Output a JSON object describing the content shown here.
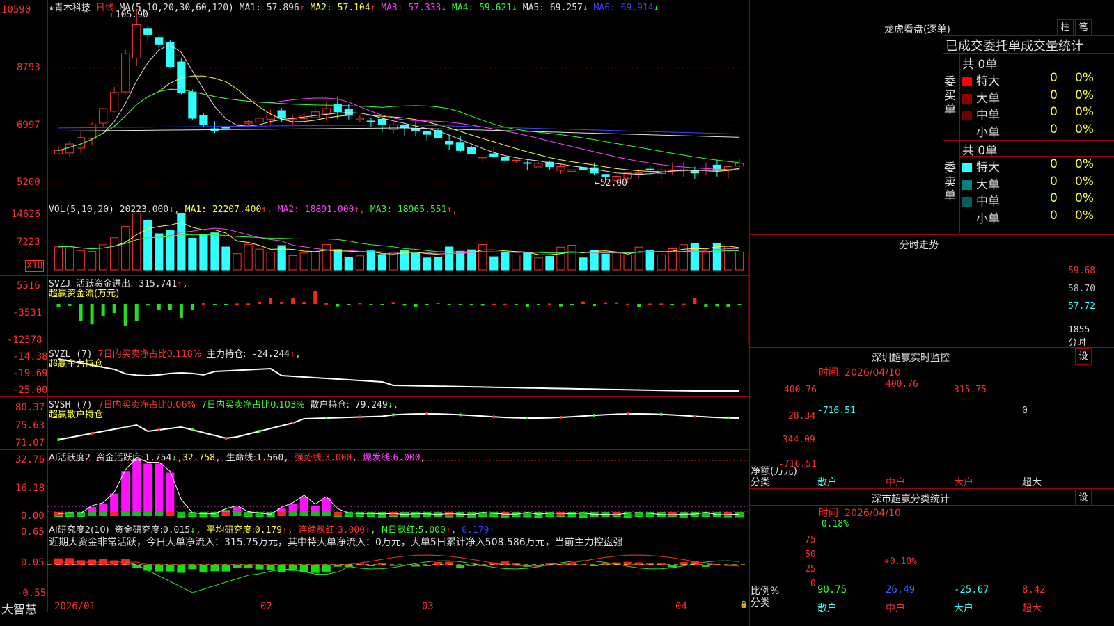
{
  "stock": {
    "name": "青木科技",
    "star": "★",
    "period": "日线"
  },
  "main_chart": {
    "ma_label": "MA(5,10,20,30,60,120)",
    "ma": [
      {
        "label": "MA1:",
        "value": "57.896",
        "arrow": "↑",
        "color": "#e0e0e0"
      },
      {
        "label": "MA2:",
        "value": "57.104",
        "arrow": "↑",
        "color": "#ffff30"
      },
      {
        "label": "MA3:",
        "value": "57.333",
        "arrow": "↓",
        "color": "#ff40ff"
      },
      {
        "label": "MA4:",
        "value": "59.621",
        "arrow": "↓",
        "color": "#30ff30"
      },
      {
        "label": "MA5:",
        "value": "69.257",
        "arrow": "↓",
        "color": "#e0e0e0"
      },
      {
        "label": "MA6:",
        "value": "69.914",
        "arrow": "↓",
        "color": "#4040ff"
      }
    ],
    "y_ticks": [
      "10590",
      "8793",
      "6997",
      "5200"
    ],
    "high_label": "105.90",
    "low_label": "52.00"
  },
  "vol": {
    "title": "VOL(5,10,20)",
    "value": "20223.000",
    "value_arrow": "↓",
    "ma": [
      {
        "label": "MA1:",
        "value": "22207.400",
        "arrow": "↑",
        "color": "#ffff30"
      },
      {
        "label": "MA2:",
        "value": "18891.000",
        "arrow": "↑",
        "color": "#ff40ff"
      },
      {
        "label": "MA3:",
        "value": "18965.551",
        "arrow": "↑",
        "color": "#30ff30"
      }
    ],
    "y_ticks": [
      "14626",
      "7223"
    ],
    "unit": "X10"
  },
  "svzj": {
    "title": "SVZJ",
    "text": "活跃资金进出:",
    "value": "315.741",
    "arrow": "↑",
    "sub": "超赢资金流(万元)",
    "y_ticks": [
      "5516",
      "-3531",
      "-12578"
    ]
  },
  "svzl": {
    "title": "SVZL (7)",
    "text1": "7日内买卖净占比0.118%",
    "text2": "主力持仓:",
    "value": "-24.244",
    "arrow": "↑",
    "sub": "超赢主力持仓",
    "y_ticks": [
      "-14.38",
      "-19.69",
      "-25.00"
    ]
  },
  "svsh": {
    "title": "SVSH (7)",
    "text1": "7日内买卖净占比0.06%",
    "text2": "7日内买卖净占比0.103%",
    "text3": "散户持仓:",
    "value": "79.249",
    "arrow": "↓",
    "sub": "超赢散户持仓",
    "y_ticks": [
      "80.37",
      "75.63",
      "71.07"
    ]
  },
  "ai1": {
    "title": "AI活跃度2",
    "t1": "资金活跃度:",
    "v1": "1.754",
    "a1": "↓",
    "v2": "32.758",
    "t3": "生命线:",
    "v3": "1.560",
    "t4": "强势线:",
    "v4": "3.000",
    "t5": "爆发线:",
    "v5": "6.000",
    "y_ticks": [
      "32.76",
      "16.18",
      "0.00"
    ]
  },
  "ai2": {
    "title": "AI研究度2(10)",
    "t1": "资金研究度:",
    "v1": "0.015",
    "a1": "↓",
    "t2": "平均研究度:",
    "v2": "0.179",
    "a2": "↑",
    "t3": "连续飘红:",
    "v3": "3.000",
    "a3": "↑",
    "t4": "N日飘红:",
    "v4": "5.000",
    "a4": "↑",
    "v5": "0.179",
    "a5": "↑",
    "summary": "近期大资金非常活跃，今日大单净流入：315.75万元，其中特大单净流入：0万元，大单5日累计净入508.586万元，当前主力控盘强",
    "y_ticks": [
      "0.65",
      "0.05",
      "-0.55"
    ]
  },
  "x_axis": {
    "labels": [
      "2026/01",
      "02",
      "03",
      "04"
    ],
    "brand": "大智慧"
  },
  "right": {
    "lhkp_title": "龙虎看盘(逐单)",
    "btn1": "柱",
    "btn2": "笔",
    "stats_title": "已成交委托单成交量统计",
    "buy_label": "委买单",
    "sell_label": "委卖单",
    "buy_total": "共 0单",
    "sell_total": "共 0单",
    "buy_rows": [
      {
        "name": "特大",
        "count": "0",
        "pct": "0%",
        "color": "#ff0000"
      },
      {
        "name": "大单",
        "count": "0",
        "pct": "0%",
        "color": "#900000"
      },
      {
        "name": "中单",
        "count": "0",
        "pct": "0%",
        "color": "#700000"
      },
      {
        "name": "小单",
        "count": "0",
        "pct": "0%",
        "color": "#000000"
      }
    ],
    "sell_rows": [
      {
        "name": "特大",
        "count": "0",
        "pct": "0%",
        "color": "#30ffff"
      },
      {
        "name": "大单",
        "count": "0",
        "pct": "0%",
        "color": "#008080"
      },
      {
        "name": "中单",
        "count": "0",
        "pct": "0%",
        "color": "#006060"
      },
      {
        "name": "小单",
        "count": "0",
        "pct": "0%",
        "color": "#000000"
      }
    ],
    "fs_title": "分时走势",
    "fs_ticks": [
      "59.68",
      "58.70",
      "57.72",
      "1855"
    ],
    "fs_unit": "分时",
    "sz_title": "深圳超赢实时监控",
    "sz_btn": "设",
    "sz_time": "时间: 2026/04/10",
    "sz_ticks": [
      "400.76",
      "28.34",
      "-344.09",
      "-716.51"
    ],
    "sz_ylabel": "净额(万元)",
    "sz_xlabel": "分类",
    "sz_bars": [
      {
        "cat": "散户",
        "value": "-716.51"
      },
      {
        "cat": "中户",
        "value": "400.76"
      },
      {
        "cat": "大户",
        "value": "315.75"
      },
      {
        "cat": "超大",
        "value": "0"
      }
    ],
    "ss_title": "深市超赢分类统计",
    "ss_btn": "设",
    "ss_time": "时间: 2026/04/10",
    "ss_ticks": [
      "75",
      "50",
      "25",
      "0"
    ],
    "ss_ylabel": "比例%",
    "ss_xlabel": "分类",
    "ss_bars": [
      {
        "cat": "散户",
        "top": "-0.18%",
        "bottom": "90.75"
      },
      {
        "cat": "中户",
        "top": "+0.10%",
        "bottom": "26.49"
      },
      {
        "cat": "大户",
        "top": "",
        "bottom": "-25.67"
      },
      {
        "cat": "超大",
        "top": "",
        "bottom": "8.42"
      }
    ]
  },
  "chart_data": {
    "type": "candlestick",
    "price_range": [
      52.0,
      105.9
    ],
    "high": 105.9,
    "low": 52.0,
    "closes": [
      62,
      64,
      66,
      70,
      75,
      80,
      92,
      101,
      98,
      95,
      88,
      80,
      72,
      70,
      68,
      69,
      70,
      71,
      72,
      73,
      72,
      72,
      73,
      74,
      75,
      74,
      73,
      72,
      71,
      70,
      70,
      69,
      68,
      67,
      66,
      64,
      62,
      61,
      60,
      60,
      59,
      59,
      58,
      58,
      57,
      57,
      56,
      56,
      55,
      54,
      54,
      55,
      55,
      56,
      56,
      56,
      56,
      55,
      56,
      56,
      57,
      58
    ],
    "sz_values": [
      -716.51,
      400.76,
      315.75,
      0
    ],
    "ss_values": [
      90.75,
      26.49,
      -25.67,
      8.42
    ]
  }
}
